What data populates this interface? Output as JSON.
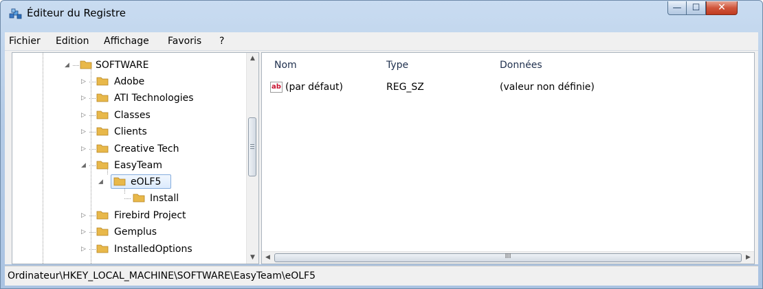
{
  "window": {
    "title": "Éditeur du Registre",
    "controls": {
      "minimize": "—",
      "maximize": "☐",
      "close": "✕"
    }
  },
  "menubar": [
    "Fichier",
    "Edition",
    "Affichage",
    "Favoris",
    "?"
  ],
  "tree": {
    "nodes": [
      {
        "label": "SOFTWARE",
        "expanded": true
      },
      {
        "label": "Adobe",
        "expanded": false
      },
      {
        "label": "ATI Technologies",
        "expanded": false
      },
      {
        "label": "Classes",
        "expanded": false
      },
      {
        "label": "Clients",
        "expanded": false
      },
      {
        "label": "Creative Tech",
        "expanded": false
      },
      {
        "label": "EasyTeam",
        "expanded": true
      },
      {
        "label": "eOLF5",
        "expanded": true,
        "selected": true
      },
      {
        "label": "Install",
        "expanded": false
      },
      {
        "label": "Firebird Project",
        "expanded": false
      },
      {
        "label": "Gemplus",
        "expanded": false
      },
      {
        "label": "InstalledOptions",
        "expanded": false
      }
    ]
  },
  "list": {
    "columns": [
      "Nom",
      "Type",
      "Données"
    ],
    "rows": [
      {
        "icon": "ab",
        "name": "(par défaut)",
        "type": "REG_SZ",
        "data": "(valeur non définie)"
      }
    ],
    "scroll_grip": "III"
  },
  "statusbar": {
    "path": "Ordinateur\\HKEY_LOCAL_MACHINE\\SOFTWARE\\EasyTeam\\eOLF5"
  },
  "colors": {
    "titlebar": "#b4cbe6",
    "selection": "#dcebfd",
    "folder": "#e8b84a",
    "close_button": "#c03a1f"
  }
}
